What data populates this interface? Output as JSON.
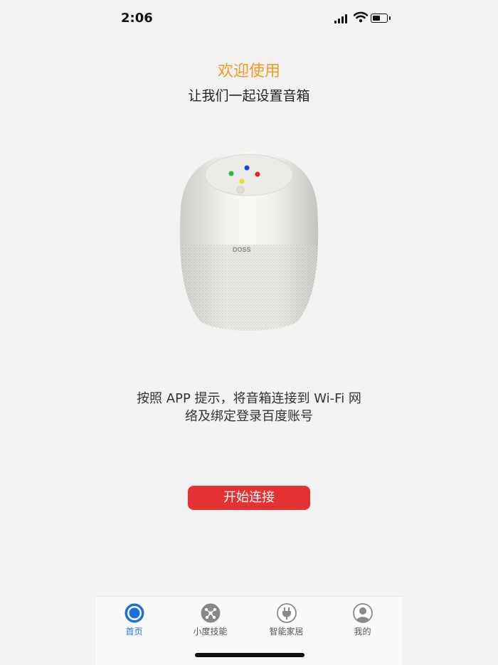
{
  "status_bar": {
    "time": "2:06",
    "battery_level": 0.55
  },
  "header": {
    "title": "欢迎使用",
    "subtitle": "让我们一起设置音箱"
  },
  "colors": {
    "accent_orange": "#f39a1c",
    "primary_red": "#e43131",
    "tab_active": "#1a6fe0",
    "tab_inactive": "#8a8a8a"
  },
  "speaker": {
    "brand": "DOSS"
  },
  "instruction": {
    "line1": "按照 APP 提示，将音箱连接到 Wi-Fi 网",
    "line2": "络及绑定登录百度账号"
  },
  "start_button": {
    "label": "开始连接"
  },
  "tabs": [
    {
      "label": "首页",
      "icon": "home-icon",
      "active": true
    },
    {
      "label": "小度技能",
      "icon": "skills-icon",
      "active": false
    },
    {
      "label": "智能家居",
      "icon": "plug-icon",
      "active": false
    },
    {
      "label": "我的",
      "icon": "profile-icon",
      "active": false
    }
  ]
}
